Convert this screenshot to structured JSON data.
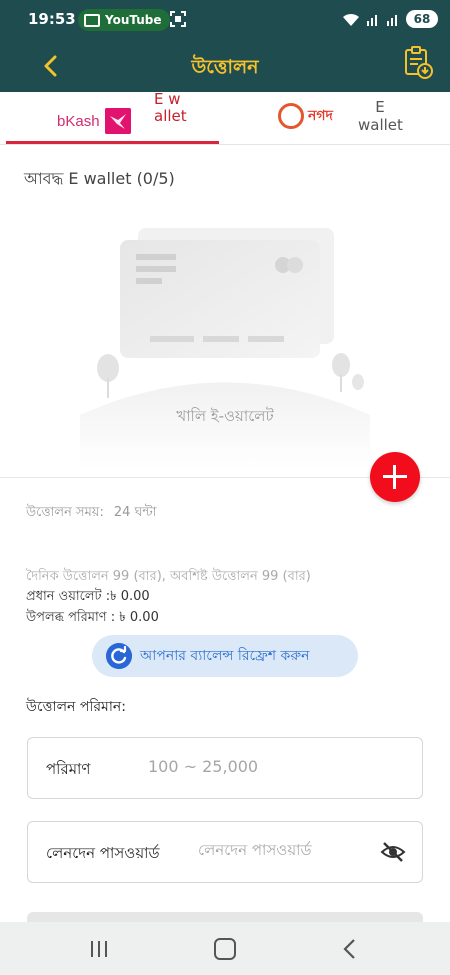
{
  "status_bar": {
    "time": "19:53",
    "app_pill": "YouTube",
    "battery": "68"
  },
  "header": {
    "title": "উত্তোলন",
    "back_icon": "chevron-left-icon",
    "history_icon": "clipboard-history-icon",
    "accent": "#f6c12a",
    "bg": "#1f4d4f"
  },
  "tabs": [
    {
      "brand": "bKash",
      "label": "E wallet",
      "active": true
    },
    {
      "brand": "নগদ",
      "label": "E wallet",
      "active": false
    }
  ],
  "wallets": {
    "title": "আবদ্ধ E wallet (0/5)",
    "empty_text": "খালি ই-ওয়ালেট"
  },
  "info": {
    "time_label": "উত্তোলন সময়:",
    "time_value": "24 ঘন্টা",
    "daily": "দৈনিক উত্তোলন 99 (বার), অবশিষ্ট উত্তোলন 99 (বার)",
    "main_wallet": "প্রধান ওয়ালেট :৳ 0.00",
    "available": "উপলব্ধ পরিমাণ : ৳ 0.00"
  },
  "refresh_button": {
    "label": "আপনার ব্যালেন্স রিফ্রেশ করুন"
  },
  "form": {
    "title": "উত্তোলন পরিমান:",
    "amount_label": "পরিমাণ",
    "amount_placeholder": "100 ~ 25,000",
    "password_label": "লেনদেন পাসওয়ার্ড",
    "password_placeholder": "লেনদেন পাসওয়ার্ড"
  },
  "colors": {
    "add_button": "#f20d1d",
    "active_tab": "#d7263d",
    "refresh_bg": "#dbe8f7"
  }
}
